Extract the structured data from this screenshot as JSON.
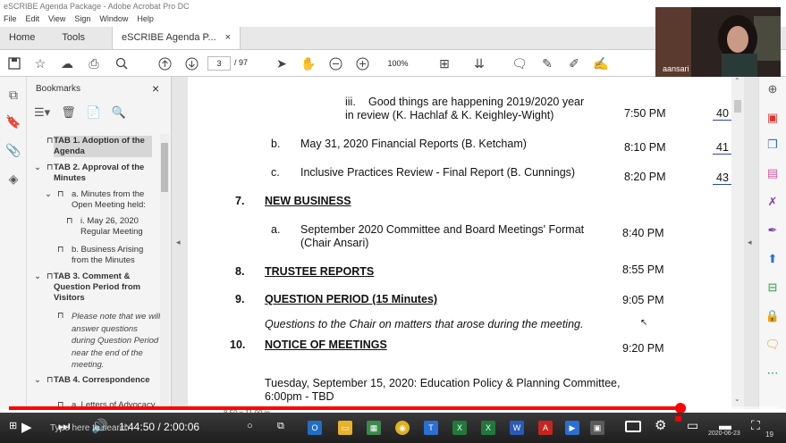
{
  "window": {
    "title": "eSCRIBE Agenda Package - Adobe Acrobat Pro DC"
  },
  "menu": [
    "File",
    "Edit",
    "View",
    "Sign",
    "Window",
    "Help"
  ],
  "tabs": {
    "home": "Home",
    "tools": "Tools",
    "doc": "eSCRIBE Agenda P...",
    "doc_close": "×"
  },
  "toolbar": {
    "page_current": "3",
    "page_total": "/ 97",
    "zoom": "100%"
  },
  "bookmarks": {
    "title": "Bookmarks",
    "close": "×",
    "items": [
      {
        "text": "TAB 1. Adoption of the Agenda",
        "bold": true,
        "selected": true
      },
      {
        "text": "TAB 2. Approval of the Minutes",
        "bold": true
      },
      {
        "text": "a. Minutes from the Open Meeting held:"
      },
      {
        "text": "i. May 26, 2020 Regular Meeting"
      },
      {
        "text": "b. Business Arising from the Minutes"
      },
      {
        "text": "TAB 3. Comment & Question Period from Visitors",
        "bold": true
      },
      {
        "text": "Please note that we will answer questions during Question Period near the end of the meeting.",
        "italic": true
      },
      {
        "text": "TAB 4. Correspondence",
        "bold": true
      },
      {
        "text": "a. Letters of Advocacy"
      }
    ]
  },
  "document": {
    "lines": [
      {
        "id": "iii",
        "num": "iii.",
        "text1": "Good things are happening 2019/2020 year",
        "text2": "in review (K. Hachlaf & K. Keighley-Wight)",
        "time": "7:50 PM",
        "page": "40"
      },
      {
        "id": "b",
        "num": "b.",
        "text1": "May 31, 2020 Financial Reports (B. Ketcham)",
        "time": "8:10 PM",
        "page": "41"
      },
      {
        "id": "c",
        "num": "c.",
        "text1": "Inclusive Practices Review - Final Report (B. Cunnings)",
        "time": "8:20 PM",
        "page": "43"
      },
      {
        "id": "7",
        "num": "7.",
        "text1": "NEW BUSINESS"
      },
      {
        "id": "a",
        "num": "a.",
        "text1": "September 2020 Committee and Board Meetings' Format",
        "text2": "(Chair Ansari)",
        "time": "8:40 PM"
      },
      {
        "id": "8",
        "num": "8.",
        "text1": "TRUSTEE REPORTS",
        "time": "8:55 PM"
      },
      {
        "id": "9",
        "num": "9.",
        "text1": "QUESTION PERIOD (15 Minutes)",
        "time": "9:05 PM"
      },
      {
        "id": "9note",
        "text1": "Questions to the Chair on matters that arose during the meeting."
      },
      {
        "id": "10",
        "num": "10.",
        "text1": "NOTICE OF MEETINGS",
        "time": "9:20 PM"
      },
      {
        "id": "tue",
        "text1": "Tuesday, September 15, 2020: Education Policy & Planning Committee,",
        "text2": "6:00pm - TBD"
      }
    ],
    "page_size": "8.50 x 11.00 in"
  },
  "webcam": {
    "name": "aansari"
  },
  "player": {
    "time": "1:44:50 / 2:00:06",
    "progress": 0.8735,
    "search_placeholder": "Type here to search",
    "clock_date": "2020-06-23",
    "lang": "19"
  },
  "colors": {
    "progress": "#ff0000",
    "link_underline": "#2a4aa5"
  }
}
